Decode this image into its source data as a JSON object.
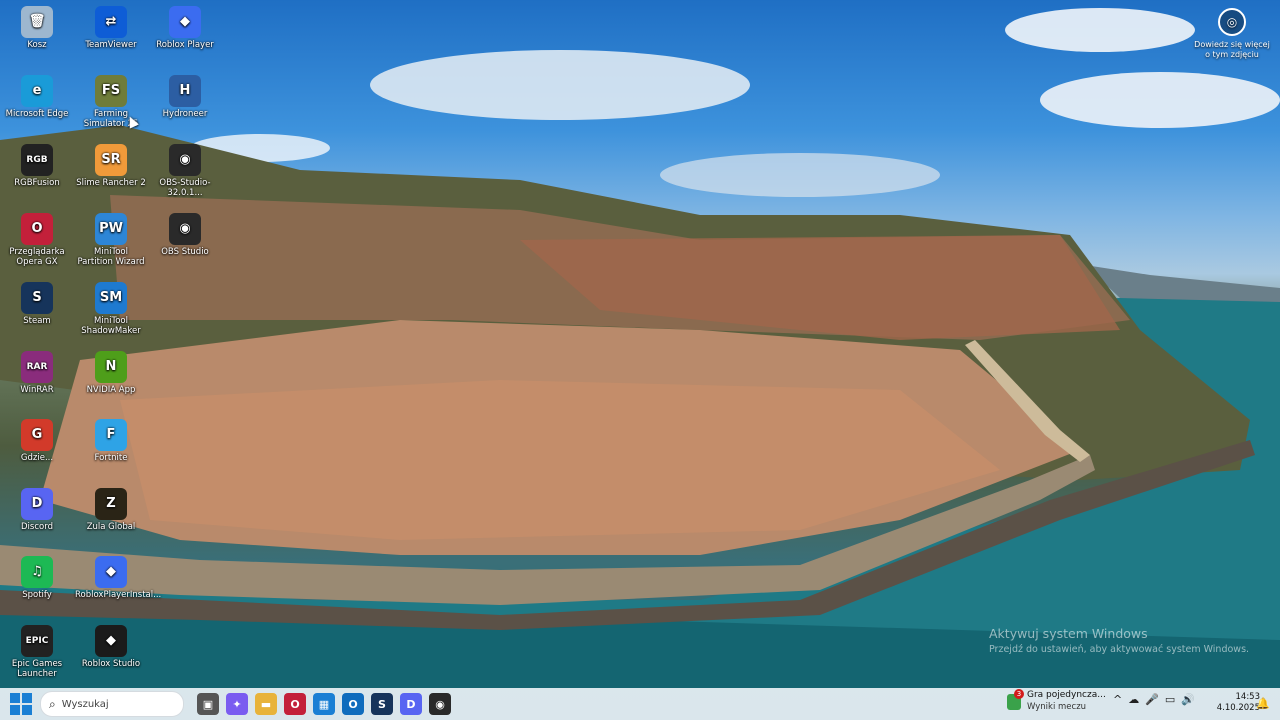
{
  "desktop": {
    "icons": [
      {
        "label": "Kosz",
        "icon": "recycle-bin-icon",
        "abbr": "🗑",
        "color": "#9db7cf"
      },
      {
        "label": "TeamViewer",
        "icon": "teamviewer-icon",
        "abbr": "⇄",
        "color": "#0e5dd6"
      },
      {
        "label": "Roblox Player",
        "icon": "roblox-icon",
        "abbr": "◆",
        "color": "#3b6cf0"
      },
      {
        "label": "Microsoft Edge",
        "icon": "edge-icon",
        "abbr": "e",
        "color": "#1a9bd8"
      },
      {
        "label": "Farming Simulator 25",
        "icon": "farming-simulator-icon",
        "abbr": "FS",
        "color": "#6f7c3a"
      },
      {
        "label": "Hydroneer",
        "icon": "hydroneer-icon",
        "abbr": "H",
        "color": "#2c5ea3"
      },
      {
        "label": "RGBFusion",
        "icon": "rgbfusion-icon",
        "abbr": "RGB",
        "color": "#222"
      },
      {
        "label": "Slime Rancher 2",
        "icon": "slime-rancher-icon",
        "abbr": "SR",
        "color": "#f09a3a"
      },
      {
        "label": "OBS-Studio-32.0.1...",
        "icon": "obs-installer-icon",
        "abbr": "◉",
        "color": "#2a2a2a"
      },
      {
        "label": "Przeglądarka Opera GX",
        "icon": "opera-gx-icon",
        "abbr": "O",
        "color": "#c3203a"
      },
      {
        "label": "MiniTool Partition Wizard",
        "icon": "minitool-partition-icon",
        "abbr": "PW",
        "color": "#2d86d6"
      },
      {
        "label": "OBS Studio",
        "icon": "obs-icon",
        "abbr": "◉",
        "color": "#2a2a2a"
      },
      {
        "label": "Steam",
        "icon": "steam-icon",
        "abbr": "S",
        "color": "#16345b"
      },
      {
        "label": "MiniTool ShadowMaker",
        "icon": "minitool-shadowmaker-icon",
        "abbr": "SM",
        "color": "#1e7ad0"
      },
      {
        "label": "WinRAR",
        "icon": "winrar-icon",
        "abbr": "RAR",
        "color": "#8a2c7c"
      },
      {
        "label": "NVIDIA App",
        "icon": "nvidia-icon",
        "abbr": "N",
        "color": "#4e9e1a"
      },
      {
        "label": "Gdzie...",
        "icon": "chrome-like-icon",
        "abbr": "G",
        "color": "#d23a2a"
      },
      {
        "label": "Fortnite",
        "icon": "fortnite-icon",
        "abbr": "F",
        "color": "#2ea3e6"
      },
      {
        "label": "Discord",
        "icon": "discord-icon",
        "abbr": "D",
        "color": "#5865f2"
      },
      {
        "label": "Zula Global",
        "icon": "zula-icon",
        "abbr": "Z",
        "color": "#2a2416"
      },
      {
        "label": "Spotify",
        "icon": "spotify-icon",
        "abbr": "♫",
        "color": "#1db954"
      },
      {
        "label": "RobloxPlayerInstal...",
        "icon": "roblox-installer-icon",
        "abbr": "◆",
        "color": "#3b6cf0"
      },
      {
        "label": "Epic Games Launcher",
        "icon": "epic-games-icon",
        "abbr": "EPIC",
        "color": "#222"
      },
      {
        "label": "Roblox Studio",
        "icon": "roblox-studio-icon",
        "abbr": "◆",
        "color": "#1b1b1b"
      }
    ],
    "spotlight": {
      "label": "Dowiedz się więcej o tym zdjęciu",
      "icon": "camera-info-icon"
    },
    "watermark": {
      "title": "Aktywuj system Windows",
      "subtitle": "Przejdź do ustawień, aby aktywować system Windows."
    }
  },
  "taskbar": {
    "search_placeholder": "Wyszukaj",
    "apps": [
      {
        "name": "task-view",
        "icon": "task-view-icon",
        "abbr": "▣",
        "color": "#555"
      },
      {
        "name": "copilot",
        "icon": "copilot-icon",
        "abbr": "✦",
        "color": "#7a5cf0"
      },
      {
        "name": "file-explorer",
        "icon": "folder-icon",
        "abbr": "▬",
        "color": "#e8b33a"
      },
      {
        "name": "opera-gx",
        "icon": "opera-gx-icon",
        "abbr": "O",
        "color": "#c3203a"
      },
      {
        "name": "microsoft-store",
        "icon": "store-icon",
        "abbr": "▦",
        "color": "#1a7fd4"
      },
      {
        "name": "outlook",
        "icon": "outlook-icon",
        "abbr": "O",
        "color": "#0f6cbd"
      },
      {
        "name": "steam",
        "icon": "steam-icon",
        "abbr": "S",
        "color": "#16345b"
      },
      {
        "name": "discord",
        "icon": "discord-icon",
        "abbr": "D",
        "color": "#5865f2"
      },
      {
        "name": "obs",
        "icon": "obs-icon",
        "abbr": "◉",
        "color": "#2a2a2a"
      }
    ],
    "notification": {
      "badge": "3",
      "title": "Gra pojedyncza...",
      "subtitle": "Wyniki meczu"
    },
    "tray": {
      "chevron": "^",
      "cloud": "☁",
      "mic": "🎤",
      "network": "▭",
      "volume": "🔊"
    },
    "clock": {
      "time": "14:53",
      "date": "4.10.2025"
    }
  }
}
